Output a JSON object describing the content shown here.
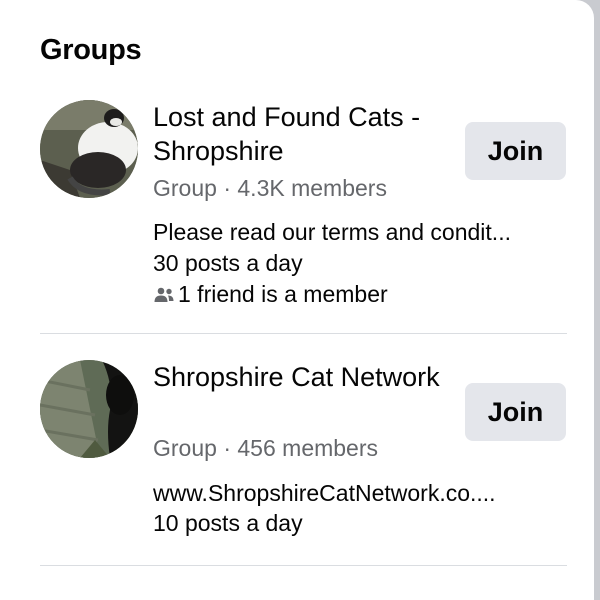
{
  "section": {
    "title": "Groups"
  },
  "groups": [
    {
      "name": "Lost and Found Cats - Shropshire",
      "type": "Group",
      "separator": "·",
      "members": "4.3K members",
      "description": "Please read our terms and condit...",
      "activity": "30 posts a day",
      "friends": "1 friend is a member",
      "join_label": "Join"
    },
    {
      "name": "Shropshire Cat Network",
      "type": "Group",
      "separator": "·",
      "members": "456 members",
      "description": "www.ShropshireCatNetwork.co....",
      "activity": "10 posts a day",
      "join_label": "Join"
    }
  ],
  "colors": {
    "text_primary": "#050505",
    "text_secondary": "#65676b",
    "button_bg": "#e4e6eb",
    "divider": "#dadde1"
  }
}
